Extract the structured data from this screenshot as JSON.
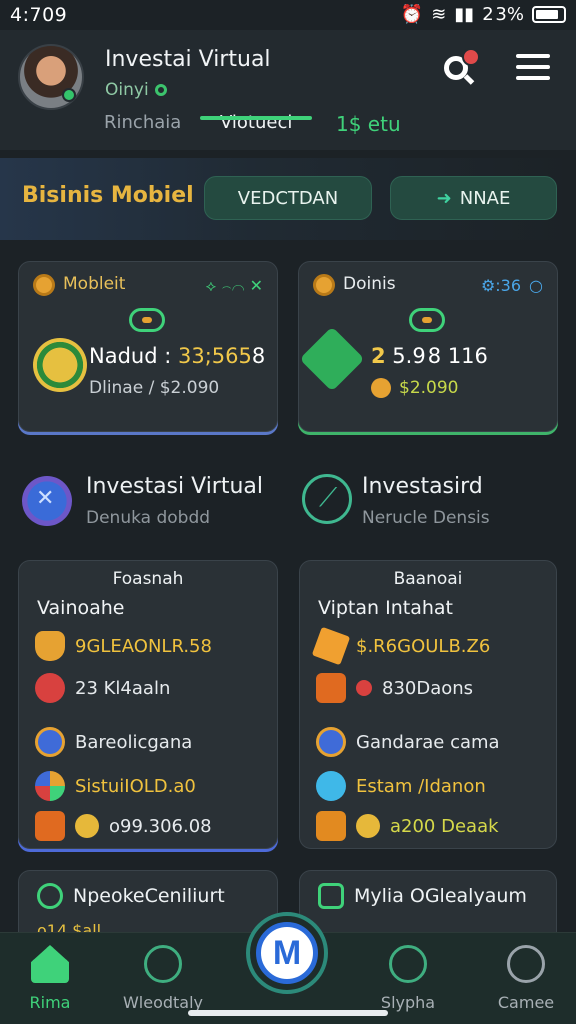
{
  "status_bar": {
    "time": "4:709",
    "battery": "2 3%"
  },
  "header": {
    "title": "Investai Virtual",
    "status": "Oinyi",
    "tabs": [
      "Rinchaia",
      "Viotuecl",
      "1$ etu"
    ]
  },
  "banner": {
    "title": "Bisinis Mobiel",
    "button_1": "VEDCTDAN",
    "button_2": "NNAE"
  },
  "wallets": [
    {
      "label": "Mobleit",
      "tools": "⟡ ⌢⌒ ✕",
      "value_label": "Nadud : ",
      "value": "33;565",
      "value_tail": "8",
      "sub": "Dlinae / $2.090"
    },
    {
      "label": "Doinis",
      "tools": "⚙:36",
      "value_prefix": "2",
      "value": " 5.9 8 116",
      "sub": "$2.090"
    }
  ],
  "features": [
    {
      "title": "Investasi Virtual",
      "subtitle": "Denuka dobdd"
    },
    {
      "title": "Investasird",
      "subtitle": "Nerucle Densis"
    }
  ],
  "portfolios": [
    {
      "header": "Foasnah",
      "subtitle": "Vainoahe",
      "rows": [
        "9GLEAONLR.58",
        "23 Kl4aaln",
        "Bareolicgana",
        "SistuiIOLD.a0",
        "o99.306.08"
      ]
    },
    {
      "header": "Baanoai",
      "subtitle": "Viptan Intahat",
      "rows": [
        "$.R6GOULB.Z6",
        "830Daons",
        "Gandarae cama",
        "Estam /Idanon",
        "a200 Deaak"
      ]
    }
  ],
  "partial_cards": [
    {
      "title": "NpeokeCeniliurt",
      "line": "o14 $all"
    },
    {
      "title": "Mylia OGlealyaum",
      "line": ""
    }
  ],
  "nav": {
    "items": [
      "Rima",
      "Wleodtaly",
      "Slypha",
      "Camee"
    ],
    "fab": "M"
  },
  "colors": {
    "accent": "#3fd27a",
    "gold": "#f0c23e",
    "background": "#1c2226",
    "card": "#2a3136"
  }
}
